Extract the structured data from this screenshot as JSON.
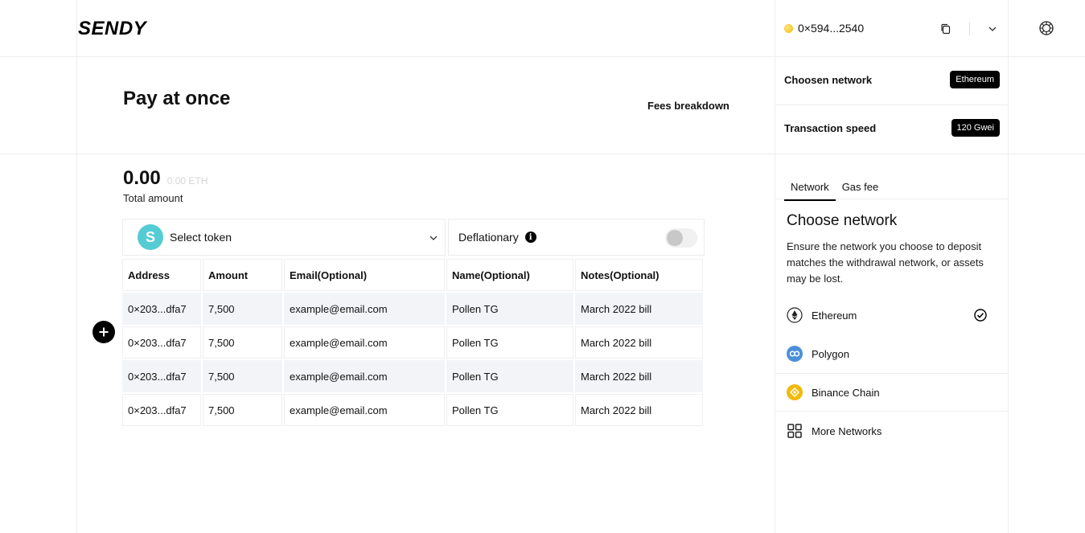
{
  "app": {
    "logo": "SENDY"
  },
  "header": {
    "wallet_address": "0×594...2540"
  },
  "page": {
    "title": "Pay at once",
    "fees_link": "Fees breakdown"
  },
  "summary": {
    "total_amount": "0.00",
    "total_eth": "0.00 ETH",
    "total_label": "Total amount"
  },
  "settings": {
    "network_label": "Choosen network",
    "network_value": "Ethereum",
    "speed_label": "Transaction speed",
    "speed_value": "120 Gwei"
  },
  "token": {
    "avatar_letter": "S",
    "label": "Select token"
  },
  "deflationary": {
    "label": "Deflationary",
    "enabled": false
  },
  "table": {
    "headers": [
      "Address",
      "Amount",
      "Email(Optional)",
      "Name(Optional)",
      "Notes(Optional)"
    ],
    "rows": [
      [
        "0×203...dfa7",
        "7,500",
        "example@email.com",
        "Pollen TG",
        "March 2022 bill"
      ],
      [
        "0×203...dfa7",
        "7,500",
        "example@email.com",
        "Pollen TG",
        "March 2022 bill"
      ],
      [
        "0×203...dfa7",
        "7,500",
        "example@email.com",
        "Pollen TG",
        "March 2022 bill"
      ],
      [
        "0×203...dfa7",
        "7,500",
        "example@email.com",
        "Pollen TG",
        "March 2022 bill"
      ]
    ]
  },
  "panel": {
    "tabs": [
      "Network",
      "Gas fee"
    ],
    "title": "Choose network",
    "description": "Ensure the network you choose to deposit matches the withdrawal network, or assets may be lost.",
    "networks": [
      {
        "name": "Ethereum",
        "icon": "ethereum-icon",
        "selected": true
      },
      {
        "name": "Polygon",
        "icon": "polygon-icon",
        "color": "#4a90d9"
      },
      {
        "name": "Binance Chain",
        "icon": "binance-icon",
        "color": "#f0b90b"
      },
      {
        "name": "More Networks",
        "icon": "grid-icon"
      }
    ]
  }
}
